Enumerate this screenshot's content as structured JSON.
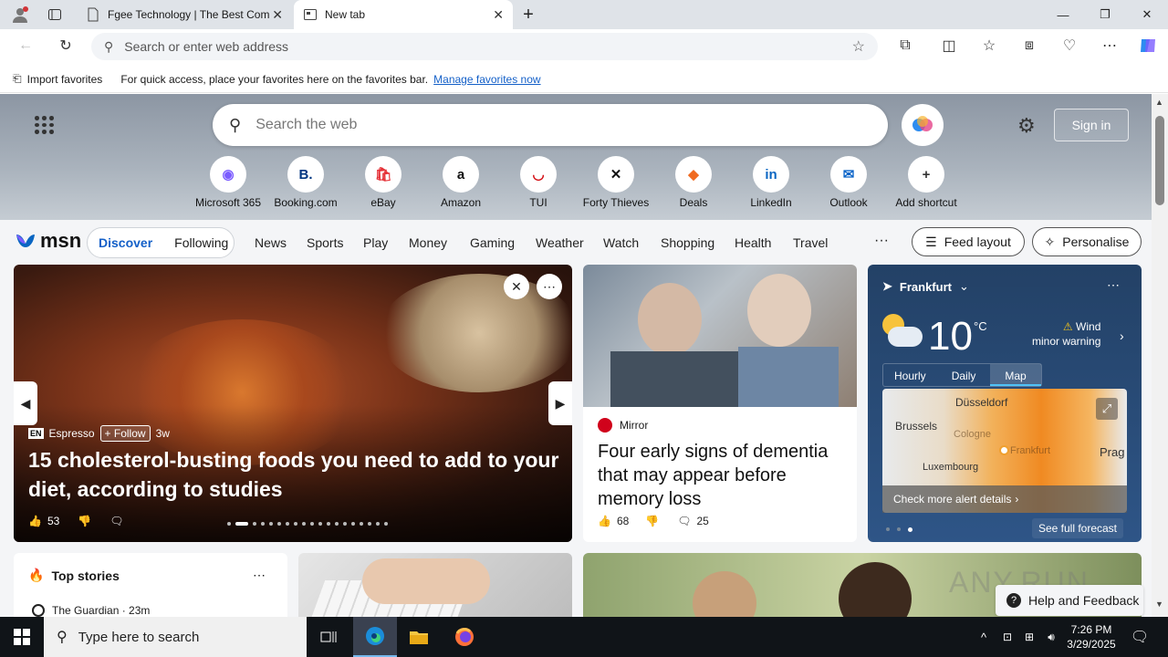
{
  "browser": {
    "tabs": [
      {
        "title": "Fgee Technology | The Best Com"
      },
      {
        "title": "New tab"
      }
    ],
    "address_placeholder": "Search or enter web address",
    "favorites_bar": {
      "import_label": "Import favorites",
      "hint": "For quick access, place your favorites here on the favorites bar.",
      "manage_link": "Manage favorites now"
    }
  },
  "newtab": {
    "search_placeholder": "Search the web",
    "signin_label": "Sign in",
    "shortcuts": [
      {
        "label": "Microsoft 365",
        "glyph": "◉",
        "color": "#7b5cff"
      },
      {
        "label": "Booking.com",
        "glyph": "B.",
        "color": "#003580"
      },
      {
        "label": "eBay",
        "glyph": "🛍",
        "color": "#e53238"
      },
      {
        "label": "Amazon",
        "glyph": "a",
        "color": "#111111"
      },
      {
        "label": "TUI",
        "glyph": "◡",
        "color": "#d40e14"
      },
      {
        "label": "Forty Thieves",
        "glyph": "✕",
        "color": "#111111"
      },
      {
        "label": "Deals",
        "glyph": "◆",
        "color": "#f06a20"
      },
      {
        "label": "LinkedIn",
        "glyph": "in",
        "color": "#0a66c2"
      },
      {
        "label": "Outlook",
        "glyph": "✉",
        "color": "#0a64c8"
      },
      {
        "label": "Add shortcut",
        "glyph": "+",
        "color": "#333333"
      }
    ]
  },
  "msn": {
    "logo": "msn",
    "feed_tabs": [
      "Discover",
      "Following"
    ],
    "nav": [
      "News",
      "Sports",
      "Play",
      "Money",
      "Gaming",
      "Weather",
      "Watch",
      "Shopping",
      "Health",
      "Travel"
    ],
    "more": "···",
    "feed_layout_label": "Feed layout",
    "personalise_label": "Personalise"
  },
  "hero": {
    "source": "Espresso",
    "follow": "+ Follow",
    "age": "3w",
    "title": "15 cholesterol-busting foods you need to add to your diet, according to studies",
    "likes": "53"
  },
  "mirror": {
    "source": "Mirror",
    "title": "Four early signs of dementia that may appear before memory loss",
    "likes": "68",
    "comments": "25"
  },
  "weather": {
    "city": "Frankfurt",
    "temp": "10",
    "unit": "°C",
    "alert_title": "Wind",
    "alert_sub": "minor warning",
    "tabs": [
      "Hourly",
      "Daily",
      "Map"
    ],
    "map_labels": [
      "Düsseldorf",
      "Brussels",
      "Luxembourg",
      "Prag",
      "Cologne",
      "Frankfurt"
    ],
    "alert_details": "Check more alert details",
    "forecast_link": "See full forecast"
  },
  "top_stories": {
    "heading": "Top stories",
    "source": "The Guardian · 23m"
  },
  "help_label": "Help and Feedback",
  "watermark": "ANY.RUN",
  "taskbar": {
    "search_placeholder": "Type here to search",
    "time": "7:26 PM",
    "date": "3/29/2025"
  }
}
